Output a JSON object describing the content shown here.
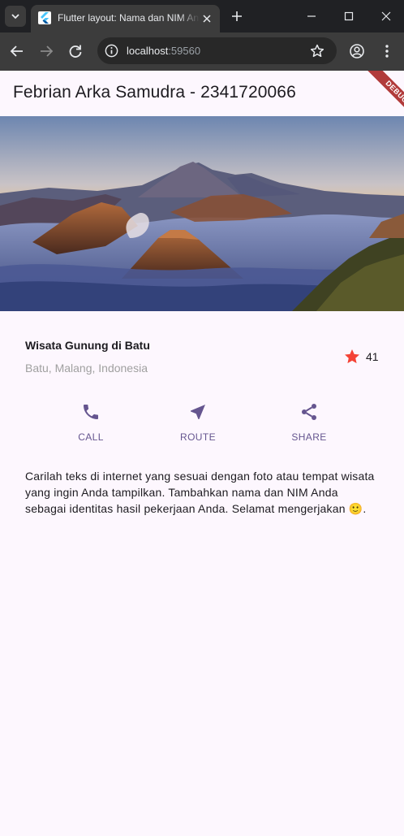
{
  "browser": {
    "tab_title": "Flutter layout: Nama dan NIM Anda",
    "url_host": "localhost",
    "url_port": ":59560"
  },
  "app": {
    "title": "Febrian Arka Samudra - 2341720066",
    "debug_label": "DEBUG"
  },
  "place": {
    "name": "Wisata Gunung di Batu",
    "location": "Batu, Malang, Indonesia",
    "rating_count": "41"
  },
  "actions": [
    {
      "label": "CALL",
      "icon": "phone-icon"
    },
    {
      "label": "ROUTE",
      "icon": "navigation-icon"
    },
    {
      "label": "SHARE",
      "icon": "share-icon"
    }
  ],
  "description": "Carilah teks di internet yang sesuai dengan foto atau tempat wisata yang ingin Anda tampilkan. Tambahkan nama dan NIM Anda sebagai identitas hasil pekerjaan Anda. Selamat mengerjakan 🙂.",
  "colors": {
    "primary": "#65558f",
    "star": "#f44336",
    "background": "#fdf7fe",
    "debug": "#b13b3b"
  }
}
